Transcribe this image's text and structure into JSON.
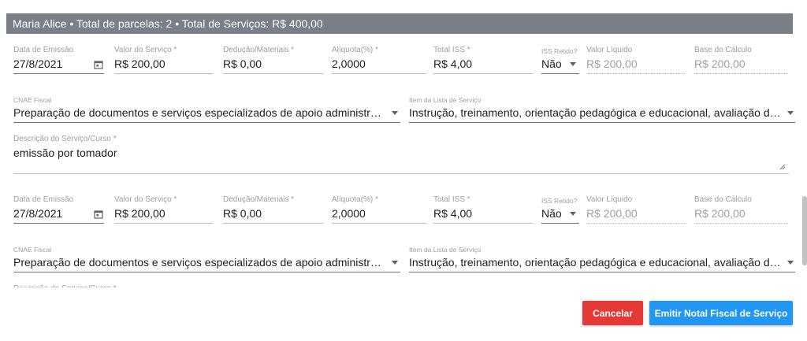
{
  "colors": {
    "header_bg": "#7b7f87",
    "cancel_bg": "#e53935",
    "emit_bg": "#2196f3"
  },
  "header": {
    "title": "Maria Alice • Total de parcelas: 2 • Total de Serviços: R$ 400,00"
  },
  "labels": {
    "data_emissao": "Data de Emissão",
    "valor_servico": "Valor do Serviço *",
    "deducao": "Dedução/Materiais *",
    "aliquota": "Alíquota(%) *",
    "total_iss": "Total ISS *",
    "iss_retido": "ISS Retido?",
    "valor_liquido": "Valor Líquido",
    "base_calculo": "Base do Cálculo",
    "cnae": "CNAE Fiscal",
    "item_lista": "Item da Lista de Serviço",
    "descricao": "Descrição do Serviço/Curso *"
  },
  "parcelas": [
    {
      "data_emissao": "27/8/2021",
      "valor_servico": "R$ 200,00",
      "deducao": "R$ 0,00",
      "aliquota": "2,0000",
      "total_iss": "R$ 4,00",
      "iss_retido": "Não",
      "valor_liquido": "R$ 200,00",
      "base_calculo": "R$ 200,00",
      "cnae": "Preparação de documentos e serviços especializados de apoio administrativo não especificados anteriormente",
      "item_lista": "Instrução, treinamento, orientação pedagógica e educacional, avaliação de conhecimentos de qualquer natureza",
      "descricao": "emissão por tomador"
    },
    {
      "data_emissao": "27/8/2021",
      "valor_servico": "R$ 200,00",
      "deducao": "R$ 0,00",
      "aliquota": "2,0000",
      "total_iss": "R$ 4,00",
      "iss_retido": "Não",
      "valor_liquido": "R$ 200,00",
      "base_calculo": "R$ 200,00",
      "cnae": "Preparação de documentos e serviços especializados de apoio administrativo não especificados anteriormente",
      "item_lista": "Instrução, treinamento, orientação pedagógica e educacional, avaliação de conhecimentos de qualquer natureza"
    }
  ],
  "icons": {
    "calendar": "calendar-icon",
    "dropdown": "caret-down-icon",
    "resize": "resize-handle-icon"
  },
  "buttons": {
    "cancel": "Cancelar",
    "emit": "Emitir Notal Fiscal de Serviço"
  }
}
